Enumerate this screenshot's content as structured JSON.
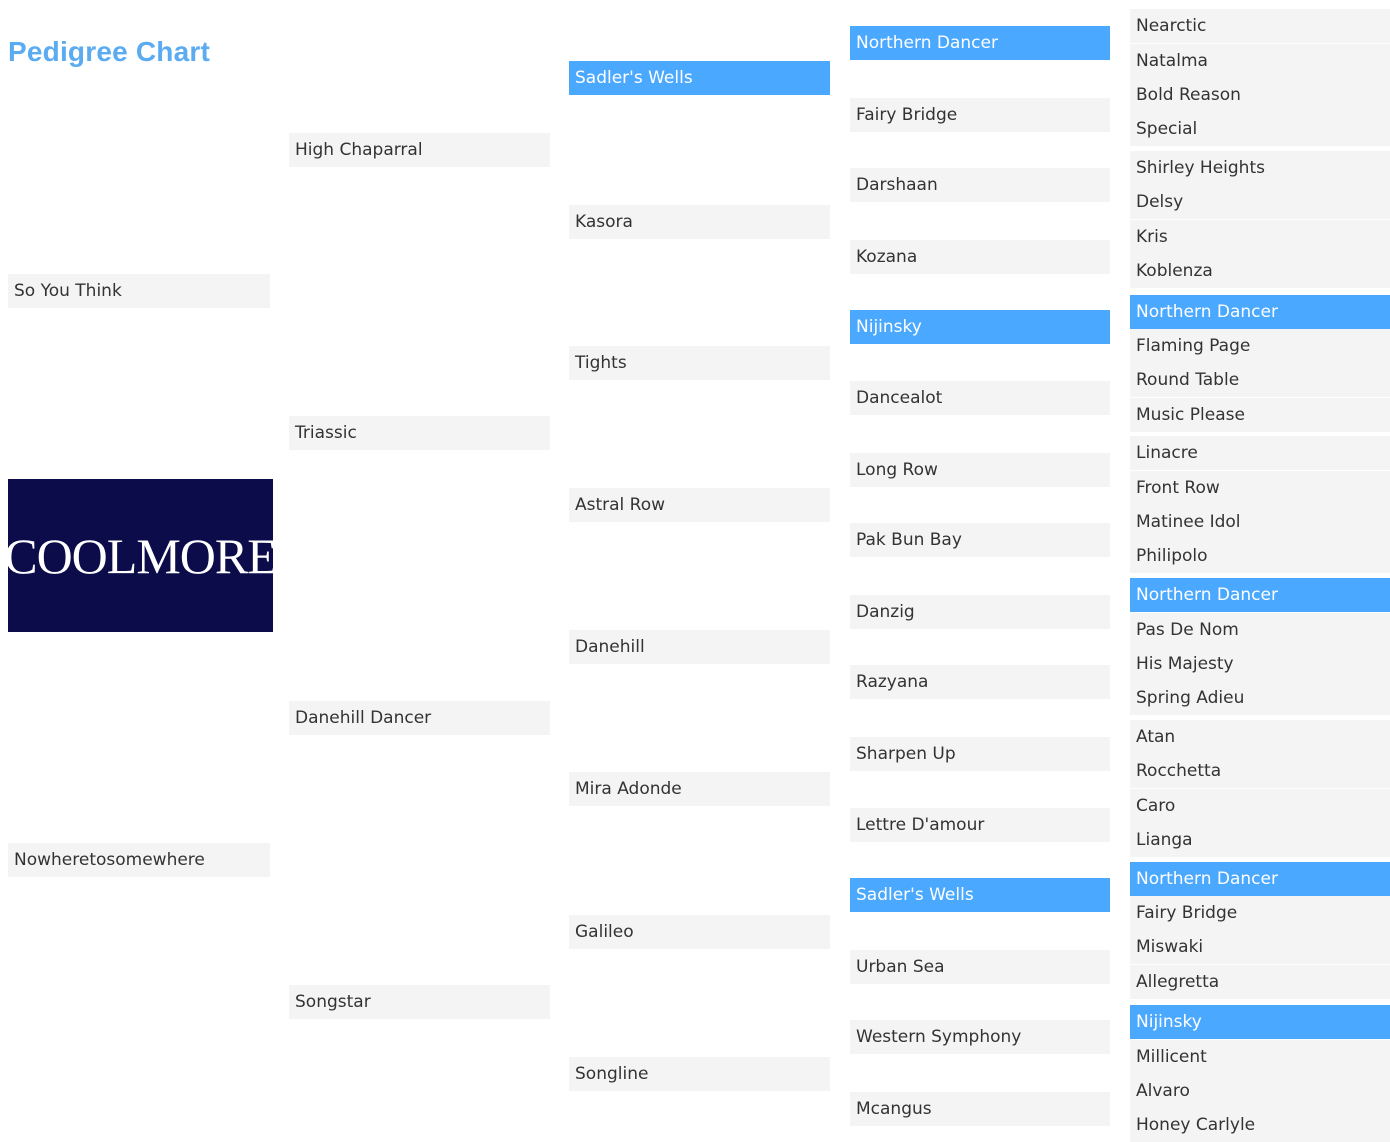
{
  "page": {
    "title": "Pedigree Chart"
  },
  "logo": {
    "text": "COOLMORE",
    "background": "#0c0c4a"
  },
  "colors": {
    "highlight": "#4aa8ff",
    "cell": "#f4f4f4",
    "title": "#5aabf2"
  },
  "gen1": [
    {
      "name": "So You Think",
      "hl": false
    },
    {
      "name": "Nowheretosomewhere",
      "hl": false
    }
  ],
  "gen2": [
    {
      "name": "High Chaparral",
      "hl": false
    },
    {
      "name": "Triassic",
      "hl": false
    },
    {
      "name": "Danehill Dancer",
      "hl": false
    },
    {
      "name": "Songstar",
      "hl": false
    }
  ],
  "gen3": [
    {
      "name": "Sadler's Wells",
      "hl": true
    },
    {
      "name": "Kasora",
      "hl": false
    },
    {
      "name": "Tights",
      "hl": false
    },
    {
      "name": "Astral Row",
      "hl": false
    },
    {
      "name": "Danehill",
      "hl": false
    },
    {
      "name": "Mira Adonde",
      "hl": false
    },
    {
      "name": "Galileo",
      "hl": false
    },
    {
      "name": "Songline",
      "hl": false
    }
  ],
  "gen4": [
    {
      "name": "Northern Dancer",
      "hl": true
    },
    {
      "name": "Fairy Bridge",
      "hl": false
    },
    {
      "name": "Darshaan",
      "hl": false
    },
    {
      "name": "Kozana",
      "hl": false
    },
    {
      "name": "Nijinsky",
      "hl": true
    },
    {
      "name": "Dancealot",
      "hl": false
    },
    {
      "name": "Long Row",
      "hl": false
    },
    {
      "name": "Pak Bun Bay",
      "hl": false
    },
    {
      "name": "Danzig",
      "hl": false
    },
    {
      "name": "Razyana",
      "hl": false
    },
    {
      "name": "Sharpen Up",
      "hl": false
    },
    {
      "name": "Lettre D'amour",
      "hl": false
    },
    {
      "name": "Sadler's Wells",
      "hl": true
    },
    {
      "name": "Urban Sea",
      "hl": false
    },
    {
      "name": "Western Symphony",
      "hl": false
    },
    {
      "name": "Mcangus",
      "hl": false
    }
  ],
  "gen5": [
    {
      "name": "Nearctic",
      "hl": false
    },
    {
      "name": "Natalma",
      "hl": false
    },
    {
      "name": "Bold Reason",
      "hl": false
    },
    {
      "name": "Special",
      "hl": false
    },
    {
      "name": "Shirley Heights",
      "hl": false
    },
    {
      "name": "Delsy",
      "hl": false
    },
    {
      "name": "Kris",
      "hl": false
    },
    {
      "name": "Koblenza",
      "hl": false
    },
    {
      "name": "Northern Dancer",
      "hl": true
    },
    {
      "name": "Flaming Page",
      "hl": false
    },
    {
      "name": "Round Table",
      "hl": false
    },
    {
      "name": "Music Please",
      "hl": false
    },
    {
      "name": "Linacre",
      "hl": false
    },
    {
      "name": "Front Row",
      "hl": false
    },
    {
      "name": "Matinee Idol",
      "hl": false
    },
    {
      "name": "Philipolo",
      "hl": false
    },
    {
      "name": "Northern Dancer",
      "hl": true
    },
    {
      "name": "Pas De Nom",
      "hl": false
    },
    {
      "name": "His Majesty",
      "hl": false
    },
    {
      "name": "Spring Adieu",
      "hl": false
    },
    {
      "name": "Atan",
      "hl": false
    },
    {
      "name": "Rocchetta",
      "hl": false
    },
    {
      "name": "Caro",
      "hl": false
    },
    {
      "name": "Lianga",
      "hl": false
    },
    {
      "name": "Northern Dancer",
      "hl": true
    },
    {
      "name": "Fairy Bridge",
      "hl": false
    },
    {
      "name": "Miswaki",
      "hl": false
    },
    {
      "name": "Allegretta",
      "hl": false
    },
    {
      "name": "Nijinsky",
      "hl": true
    },
    {
      "name": "Millicent",
      "hl": false
    },
    {
      "name": "Alvaro",
      "hl": false
    },
    {
      "name": "Honey Carlyle",
      "hl": false
    }
  ]
}
